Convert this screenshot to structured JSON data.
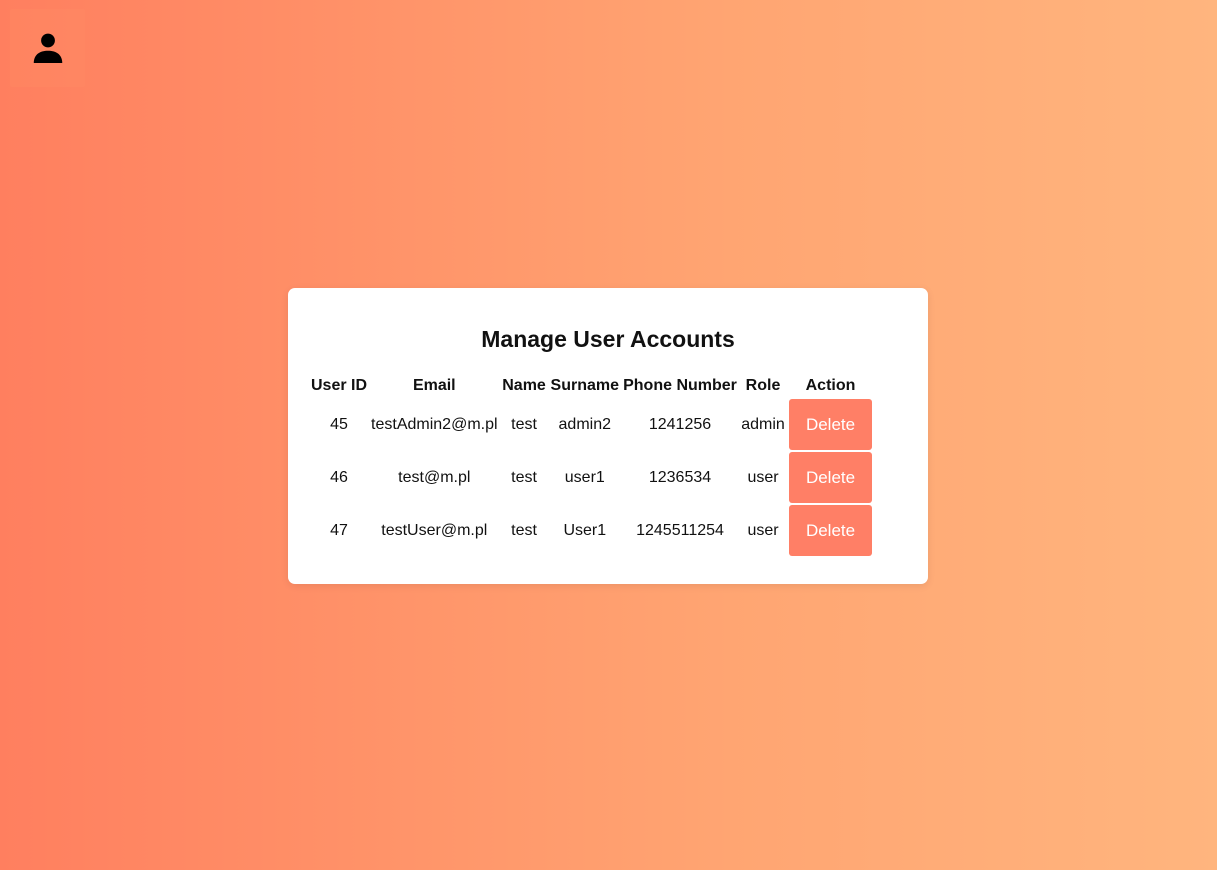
{
  "profile": {
    "icon": "person-icon"
  },
  "card": {
    "title": "Manage User Accounts",
    "columns": [
      "User ID",
      "Email",
      "Name",
      "Surname",
      "Phone Number",
      "Role",
      "Action"
    ],
    "rows": [
      {
        "id": "45",
        "email": "testAdmin2@m.pl",
        "name": "test",
        "surname": "admin2",
        "phone": "1241256",
        "role": "admin",
        "action": "Delete"
      },
      {
        "id": "46",
        "email": "test@m.pl",
        "name": "test",
        "surname": "user1",
        "phone": "1236534",
        "role": "user",
        "action": "Delete"
      },
      {
        "id": "47",
        "email": "testUser@m.pl",
        "name": "test",
        "surname": "User1",
        "phone": "1245511254",
        "role": "user",
        "action": "Delete"
      }
    ]
  },
  "colors": {
    "gradient_start": "#ff7f5f",
    "gradient_end": "#ffb57e",
    "delete_button": "#ff7f66"
  }
}
